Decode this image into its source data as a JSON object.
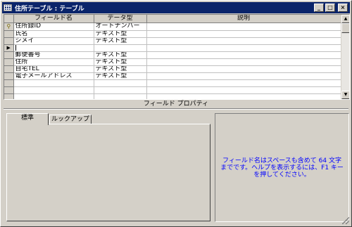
{
  "window": {
    "title": "住所テーブル : テーブル",
    "minimize_glyph": "_",
    "maximize_glyph": "□",
    "close_glyph": "×"
  },
  "grid": {
    "headers": {
      "field_name": "フィールド名",
      "data_type": "データ型",
      "description": "説明"
    },
    "rows": [
      {
        "marker": "key-icon",
        "field_name": "住所録ID",
        "data_type": "オートナンバー",
        "description": ""
      },
      {
        "marker": "",
        "field_name": "氏名",
        "data_type": "テキスト型",
        "description": ""
      },
      {
        "marker": "",
        "field_name": "シメイ",
        "data_type": "テキスト型",
        "description": ""
      },
      {
        "marker": "current-row-arrow",
        "field_name": "",
        "data_type": "",
        "description": ""
      },
      {
        "marker": "",
        "field_name": "郵便番号",
        "data_type": "テキスト型",
        "description": ""
      },
      {
        "marker": "",
        "field_name": "住所",
        "data_type": "テキスト型",
        "description": ""
      },
      {
        "marker": "",
        "field_name": "自宅TEL",
        "data_type": "テキスト型",
        "description": ""
      },
      {
        "marker": "",
        "field_name": "電子メールアドレス",
        "data_type": "テキスト型",
        "description": ""
      },
      {
        "marker": "",
        "field_name": "",
        "data_type": "",
        "description": ""
      },
      {
        "marker": "",
        "field_name": "",
        "data_type": "",
        "description": ""
      },
      {
        "marker": "",
        "field_name": "",
        "data_type": "",
        "description": ""
      }
    ]
  },
  "properties": {
    "caption": "フィールド プロパティ",
    "tabs": [
      {
        "label": "標準",
        "active": true
      },
      {
        "label": "ルックアップ",
        "active": false
      }
    ],
    "help_text": "フィールド名はスペースも含めて 64 文字までです。ヘルプを表示するには、F1 キーを押してください。"
  },
  "colors": {
    "titlebar": "#0a246a",
    "help_text": "#0000ff",
    "face": "#d4d0c8"
  }
}
